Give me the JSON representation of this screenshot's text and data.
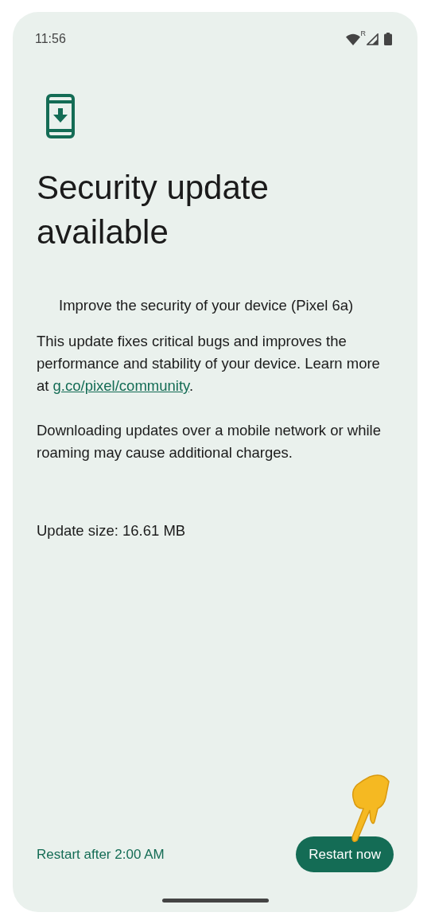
{
  "status_bar": {
    "time": "11:56",
    "roaming_mark": "R"
  },
  "title": "Security update available",
  "subtitle": "Improve the security of your device (Pixel 6a)",
  "description": {
    "before": "This update fixes critical bugs and improves the performance and stability of your device. Learn more at ",
    "link": "g.co/pixel/community",
    "after": "."
  },
  "notice": "Downloading updates over a mobile network or while roaming may cause additional charges.",
  "update_size": "Update size: 16.61 MB",
  "buttons": [
    {
      "label": "Restart after 2:00 AM",
      "kind": "text"
    },
    {
      "label": "Restart now",
      "kind": "filled"
    }
  ]
}
